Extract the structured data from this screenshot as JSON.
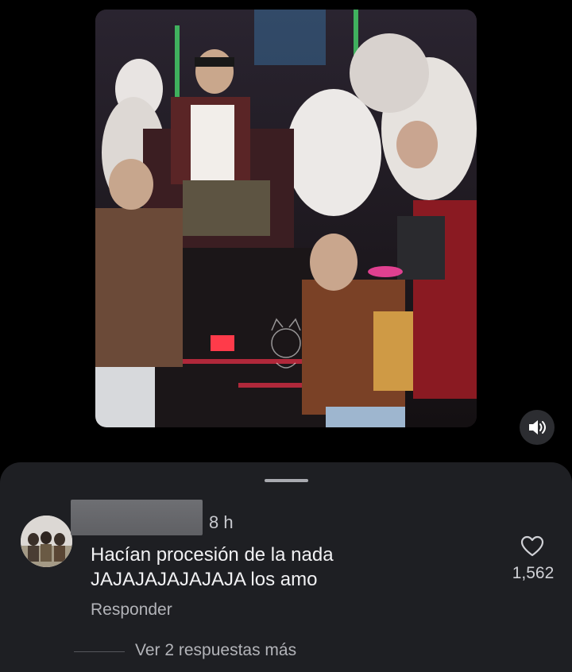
{
  "post": {
    "video": {
      "description_icon": "concert-video",
      "audio_control": "speaker-icon"
    }
  },
  "comments": {
    "item": {
      "time": "8 h",
      "text_line1": "Hacían procesión de la nada",
      "text_line2": "JAJAJAJAJAJAJA los amo",
      "reply_label": "Responder",
      "like_count": "1,562",
      "like_icon": "heart-outline-icon"
    },
    "more_replies_label": "Ver 2 respuestas más"
  },
  "colors": {
    "background": "#000000",
    "sheet": "#1e1f23",
    "primary_text": "#f1f1f3",
    "secondary_text": "#b3b4b9"
  }
}
